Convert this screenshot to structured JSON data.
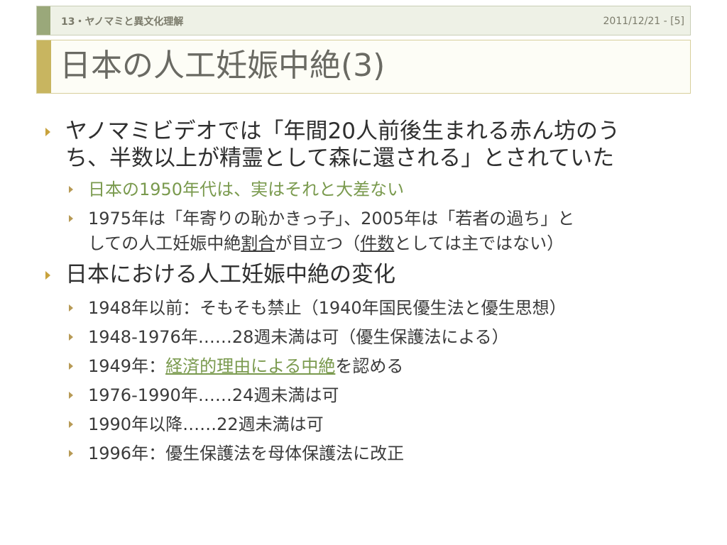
{
  "header": {
    "section": "13・ヤノマミと異文化理解",
    "date_page": "2011/12/21 - [5]"
  },
  "title": "日本の人工妊娠中絶(3)",
  "bullets": {
    "b1_line1": "ヤノマミビデオでは「年間20人前後生まれる赤ん坊のう",
    "b1_line2": "ち、半数以上が精霊として森に還される」とされていた",
    "b1_sub1": "日本の1950年代は、実はそれと大差ない",
    "b1_sub2_line1": "1975年は「年寄りの恥かきっ子」、2005年は「若者の過ち」と",
    "b1_sub2_line2a": "しての人工妊娠中絶",
    "b1_sub2_line2b": "割合",
    "b1_sub2_line2c": "が目立つ（",
    "b1_sub2_line2d": "件数",
    "b1_sub2_line2e": "としては主ではない）",
    "b2": "日本における人工妊娠中絶の変化",
    "b2_sub1": "1948年以前：そもそも禁止（1940年国民優生法と優生思想）",
    "b2_sub2": "1948-1976年……28週未満は可（優生保護法による）",
    "b2_sub3a": "1949年：",
    "b2_sub3b": "経済的理由による中絶",
    "b2_sub3c": "を認める",
    "b2_sub4": "1976-1990年……24週未満は可",
    "b2_sub5": "1990年以降……22週未満は可",
    "b2_sub6": "1996年：優生保護法を母体保護法に改正"
  },
  "colors": {
    "accent_header": "#9aa87a",
    "accent_title": "#c8b560",
    "bullet_marker": "#c8a23c",
    "green_text": "#7a9a4e"
  }
}
